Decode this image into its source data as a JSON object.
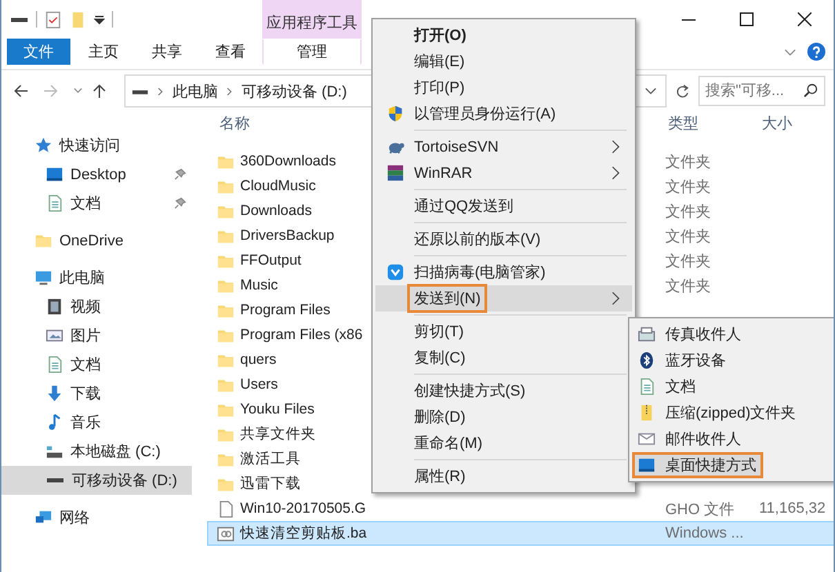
{
  "ribbon": {
    "context_group": "应用程序工具",
    "tabs": [
      {
        "label": "文件",
        "kind": "file",
        "selected": false
      },
      {
        "label": "主页",
        "kind": "tab",
        "selected": false
      },
      {
        "label": "共享",
        "kind": "tab",
        "selected": false
      },
      {
        "label": "查看",
        "kind": "tab",
        "selected": false
      },
      {
        "label": "管理",
        "kind": "context",
        "selected": false
      }
    ]
  },
  "address_bar": {
    "path": [
      "此电脑",
      "可移动设备 (D:)"
    ]
  },
  "search": {
    "placeholder": "搜索\"可移..."
  },
  "columns": [
    "名称",
    "类型",
    "大小"
  ],
  "navigation": [
    {
      "label": "快速访问",
      "selected": false,
      "children": [
        {
          "label": "Desktop",
          "pinned": true,
          "selected": false
        },
        {
          "label": "文档",
          "pinned": true,
          "selected": false
        }
      ]
    },
    {
      "label": "OneDrive",
      "selected": false
    },
    {
      "label": "此电脑",
      "selected": false,
      "children": [
        {
          "label": "视频",
          "selected": false
        },
        {
          "label": "图片",
          "selected": false
        },
        {
          "label": "文档",
          "selected": false
        },
        {
          "label": "下载",
          "selected": false
        },
        {
          "label": "音乐",
          "selected": false
        },
        {
          "label": "本地磁盘 (C:)",
          "selected": false
        },
        {
          "label": "可移动设备 (D:)",
          "selected": true
        }
      ]
    },
    {
      "label": "网络",
      "selected": false
    }
  ],
  "files": [
    {
      "name": "360Downloads",
      "kind": "folder",
      "type": "文件夹",
      "selected": false
    },
    {
      "name": "CloudMusic",
      "kind": "folder",
      "type": "文件夹",
      "selected": false
    },
    {
      "name": "Downloads",
      "kind": "folder",
      "type": "文件夹",
      "selected": false
    },
    {
      "name": "DriversBackup",
      "kind": "folder",
      "type": "文件夹",
      "selected": false
    },
    {
      "name": "FFOutput",
      "kind": "folder",
      "type": "文件夹",
      "selected": false
    },
    {
      "name": "Music",
      "kind": "folder",
      "type": "文件夹",
      "selected": false
    },
    {
      "name": "Program Files",
      "kind": "folder",
      "selected": false
    },
    {
      "name": "Program Files (x86",
      "kind": "folder",
      "selected": false
    },
    {
      "name": "quers",
      "kind": "folder",
      "selected": false
    },
    {
      "name": "Users",
      "kind": "folder",
      "selected": false
    },
    {
      "name": "Youku Files",
      "kind": "folder",
      "selected": false
    },
    {
      "name": "共享文件夹",
      "kind": "folder",
      "selected": false
    },
    {
      "name": "激活工具",
      "kind": "folder",
      "selected": false
    },
    {
      "name": "迅雷下载",
      "kind": "folder",
      "selected": false
    },
    {
      "name": "Win10-20170505.G",
      "kind": "file",
      "type": "GHO 文件",
      "size": "11,165,32",
      "selected": false
    },
    {
      "name": "快速清空剪贴板.ba",
      "kind": "script",
      "type": "Windows ...",
      "selected": true
    }
  ],
  "context_menu": [
    {
      "kind": "item",
      "label": "打开(O)",
      "bold": true,
      "submenu": false,
      "selected": false
    },
    {
      "kind": "item",
      "label": "编辑(E)",
      "bold": false,
      "submenu": false,
      "selected": false
    },
    {
      "kind": "item",
      "label": "打印(P)",
      "bold": false,
      "submenu": false,
      "selected": false
    },
    {
      "kind": "item",
      "label": "以管理员身份运行(A)",
      "bold": false,
      "submenu": false,
      "selected": false
    },
    {
      "kind": "separator"
    },
    {
      "kind": "item",
      "label": "TortoiseSVN",
      "bold": false,
      "submenu": true,
      "selected": false
    },
    {
      "kind": "item",
      "label": "WinRAR",
      "bold": false,
      "submenu": true,
      "selected": false
    },
    {
      "kind": "separator"
    },
    {
      "kind": "item",
      "label": "通过QQ发送到",
      "bold": false,
      "submenu": false,
      "selected": false
    },
    {
      "kind": "separator"
    },
    {
      "kind": "item",
      "label": "还原以前的版本(V)",
      "bold": false,
      "submenu": false,
      "selected": false
    },
    {
      "kind": "separator"
    },
    {
      "kind": "item",
      "label": "扫描病毒(电脑管家)",
      "bold": false,
      "submenu": false,
      "selected": false
    },
    {
      "kind": "item",
      "label": "发送到(N)",
      "bold": false,
      "submenu": true,
      "selected": true
    },
    {
      "kind": "separator"
    },
    {
      "kind": "item",
      "label": "剪切(T)",
      "bold": false,
      "submenu": false,
      "selected": false
    },
    {
      "kind": "item",
      "label": "复制(C)",
      "bold": false,
      "submenu": false,
      "selected": false
    },
    {
      "kind": "separator"
    },
    {
      "kind": "item",
      "label": "创建快捷方式(S)",
      "bold": false,
      "submenu": false,
      "selected": false
    },
    {
      "kind": "item",
      "label": "删除(D)",
      "bold": false,
      "submenu": false,
      "selected": false
    },
    {
      "kind": "item",
      "label": "重命名(M)",
      "bold": false,
      "submenu": false,
      "selected": false
    },
    {
      "kind": "separator"
    },
    {
      "kind": "item",
      "label": "属性(R)",
      "bold": false,
      "submenu": false,
      "selected": false
    }
  ],
  "send_to_menu": [
    {
      "label": "传真收件人",
      "selected": false
    },
    {
      "label": "蓝牙设备",
      "selected": false
    },
    {
      "label": "文档",
      "selected": false
    },
    {
      "label": "压缩(zipped)文件夹",
      "selected": false
    },
    {
      "label": "邮件收件人",
      "selected": false
    },
    {
      "label": "桌面快捷方式",
      "selected": true
    }
  ]
}
